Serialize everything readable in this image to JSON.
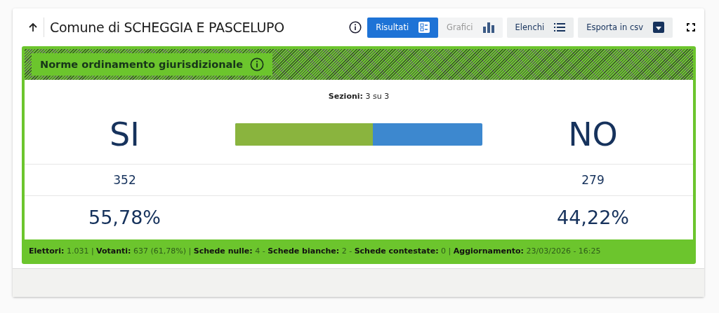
{
  "title": "Comune di SCHEGGIA E PASCELUPO",
  "tabs": [
    {
      "label": "Risultati",
      "selected": true,
      "disabled": false,
      "kind": "list-card"
    },
    {
      "label": "Grafici",
      "selected": false,
      "disabled": true,
      "kind": "bars"
    },
    {
      "label": "Elenchi",
      "selected": false,
      "disabled": false,
      "kind": "list"
    },
    {
      "label": "Esporta in csv",
      "selected": false,
      "disabled": false,
      "kind": "download"
    }
  ],
  "referendum": {
    "title": "Norme ordinamento giurisdizionale",
    "sections": "**Sezioni:** 3 su 3",
    "yes": {
      "label": "SI",
      "votes": "352",
      "percent": "55,78%",
      "color": "#8ab43e",
      "level": 0.5578
    },
    "no": {
      "label": "NO",
      "votes": "279",
      "percent": "44,22%",
      "color": "#3d88cf"
    },
    "footer": "**Elettori:** 1.031 | **Votanti:** 637 (61,78%) | **Schede nulle:** 4 - **Schede bianche:** 2 - **Schede contestate:** 0 | **Aggiornamento:** 23/03/2026 - 16:25"
  }
}
